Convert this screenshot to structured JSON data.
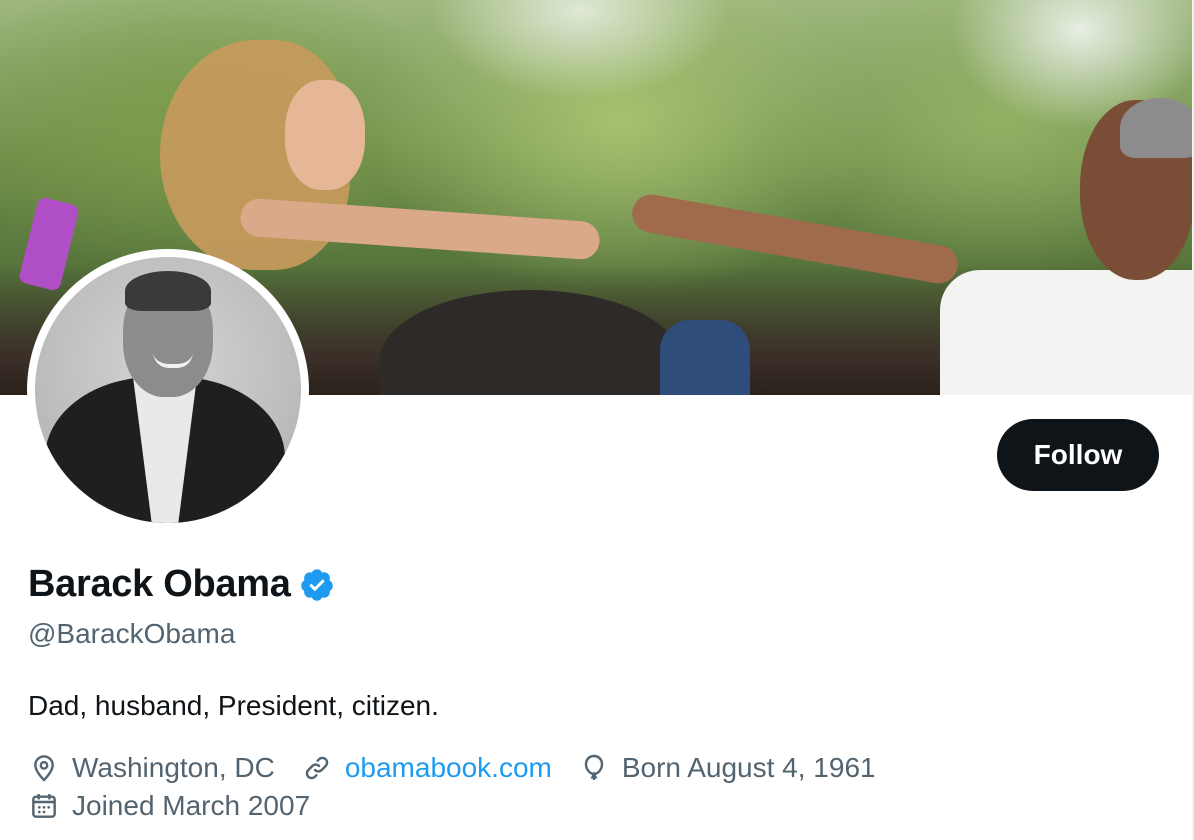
{
  "profile": {
    "name": "Barack Obama",
    "handle": "@BarackObama",
    "bio": "Dad, husband, President, citizen.",
    "verified": true,
    "location": "Washington, DC",
    "website": "obamabook.com",
    "birthday": "Born August 4, 1961",
    "joined": "Joined March 2007"
  },
  "actions": {
    "follow_label": "Follow"
  },
  "icons": {
    "verified": "verified-badge-icon",
    "location": "location-pin-icon",
    "link": "link-icon",
    "birthday": "balloon-icon",
    "joined": "calendar-icon"
  },
  "colors": {
    "accent": "#1d9bf0",
    "text_primary": "#0f1419",
    "text_secondary": "#536471",
    "follow_bg": "#0f1419"
  }
}
